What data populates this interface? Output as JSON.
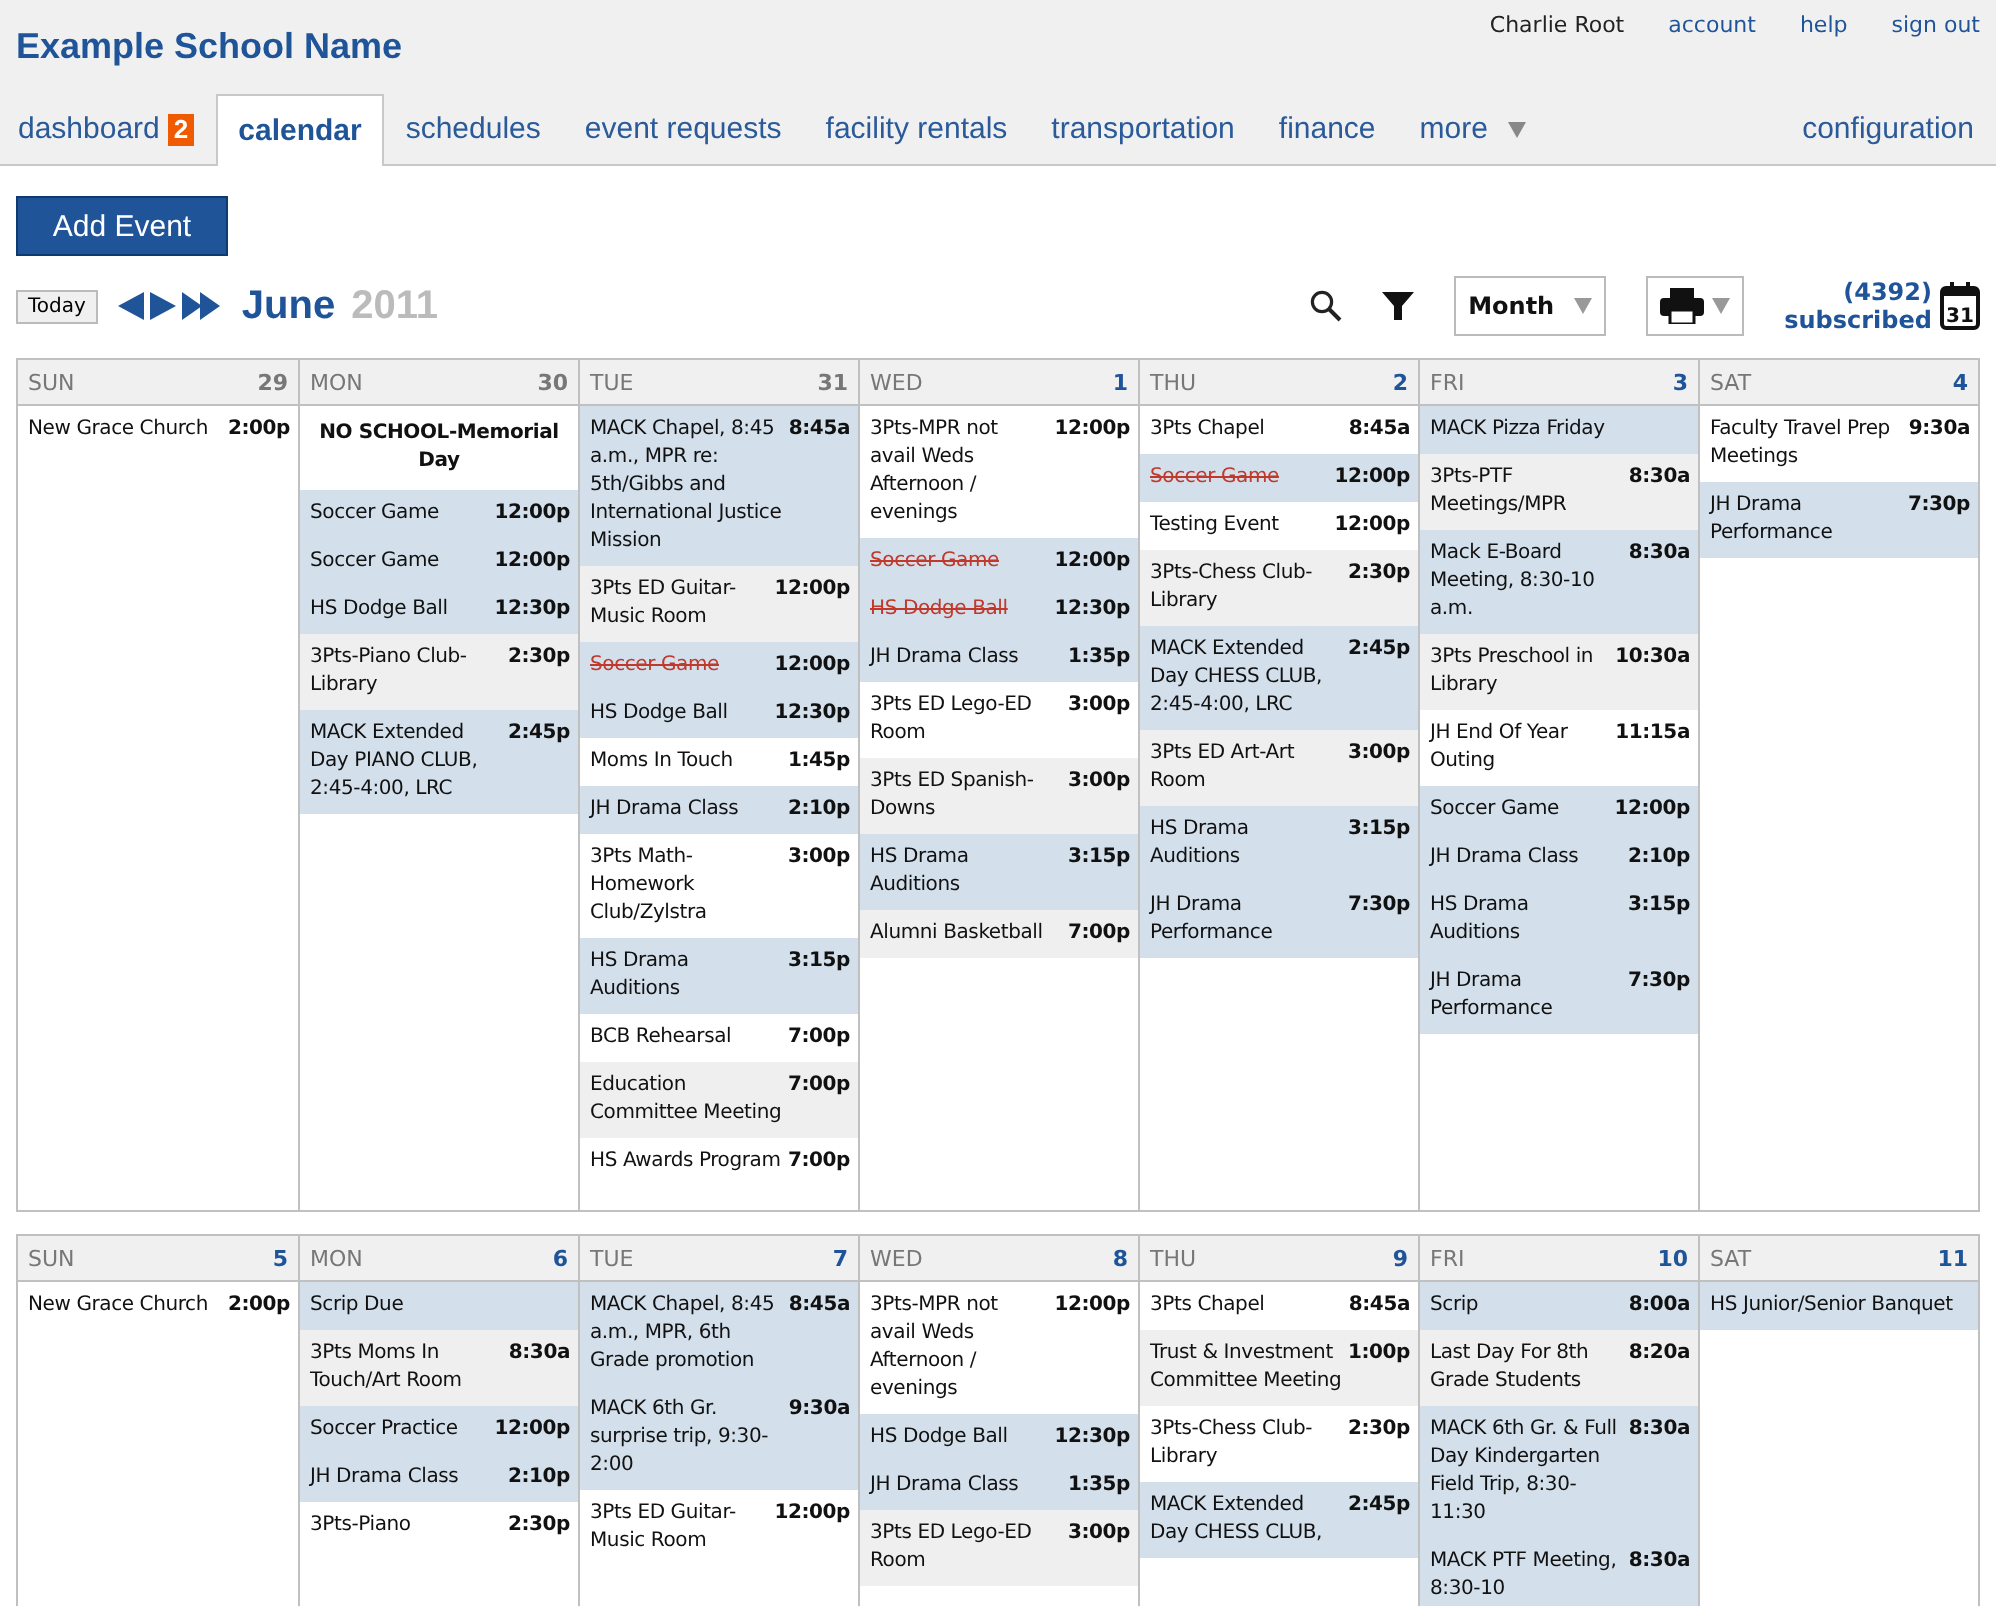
{
  "school_name": "Example School Name",
  "user_links": [
    {
      "label": "Charlie Root",
      "kind": "text"
    },
    {
      "label": "account",
      "kind": "link"
    },
    {
      "label": "help",
      "kind": "link"
    },
    {
      "label": "sign out",
      "kind": "link"
    }
  ],
  "tabs": [
    {
      "label": "dashboard",
      "badge": "2",
      "selected": false,
      "menu": false
    },
    {
      "label": "calendar",
      "selected": true,
      "menu": false
    },
    {
      "label": "schedules",
      "selected": false,
      "menu": false
    },
    {
      "label": "event requests",
      "selected": false,
      "menu": false
    },
    {
      "label": "facility rentals",
      "selected": false,
      "menu": false
    },
    {
      "label": "transportation",
      "selected": false,
      "menu": false
    },
    {
      "label": "finance",
      "selected": false,
      "menu": false
    },
    {
      "label": "more",
      "selected": false,
      "menu": true
    }
  ],
  "right_tab": {
    "label": "configuration"
  },
  "add_button": "Add Event",
  "toolbar": {
    "today": "Today",
    "month": "June",
    "year": "2011",
    "view_select": "Month",
    "count": "(4392)",
    "subscribed": "subscribed",
    "calendar_icon_label": "31"
  },
  "weeks": [
    {
      "days": [
        {
          "dow": "SUN",
          "date": "29",
          "other_month": true,
          "events": [
            {
              "kind": "event",
              "title": "New Grace Church",
              "time": "2:00p",
              "color": "#ffffff",
              "cancelled": false
            }
          ]
        },
        {
          "dow": "MON",
          "date": "30",
          "other_month": true,
          "events": [
            {
              "kind": "holiday",
              "title": "NO SCHOOL-Memorial Day",
              "color": "#ffffff",
              "cancelled": false
            },
            {
              "kind": "event",
              "title": "Soccer Game",
              "time": "12:00p",
              "color": "#d3dfeb",
              "cancelled": false
            },
            {
              "kind": "event",
              "title": "Soccer Game",
              "time": "12:00p",
              "color": "#d3dfeb",
              "cancelled": false
            },
            {
              "kind": "event",
              "title": "HS Dodge Ball",
              "time": "12:30p",
              "color": "#d3dfeb",
              "cancelled": false
            },
            {
              "kind": "event",
              "title": "3Pts-Piano Club-Library",
              "time": "2:30p",
              "color": "#efefef",
              "cancelled": false
            },
            {
              "kind": "event",
              "title": "MACK Extended Day PIANO CLUB, 2:45-4:00, LRC",
              "time": "2:45p",
              "color": "#d3dfeb",
              "cancelled": false
            }
          ]
        },
        {
          "dow": "TUE",
          "date": "31",
          "other_month": true,
          "events": [
            {
              "kind": "event",
              "title": "MACK Chapel, 8:45 a.m., MPR re: 5th/Gibbs and International Justice Mission",
              "time": "8:45a",
              "color": "#d3dfeb",
              "cancelled": false
            },
            {
              "kind": "event",
              "title": "3Pts ED Guitar-Music Room",
              "time": "12:00p",
              "color": "#efefef",
              "cancelled": false
            },
            {
              "kind": "event",
              "title": "Soccer Game",
              "time": "12:00p",
              "color": "#d3dfeb",
              "cancelled": true
            },
            {
              "kind": "event",
              "title": "HS Dodge Ball",
              "time": "12:30p",
              "color": "#d3dfeb",
              "cancelled": false
            },
            {
              "kind": "event",
              "title": "Moms In Touch",
              "time": "1:45p",
              "color": "#ffffff",
              "cancelled": false
            },
            {
              "kind": "event",
              "title": "JH Drama Class",
              "time": "2:10p",
              "color": "#d3dfeb",
              "cancelled": false
            },
            {
              "kind": "event",
              "title": "3Pts Math-Homework Club/Zylstra",
              "time": "3:00p",
              "color": "#ffffff",
              "cancelled": false
            },
            {
              "kind": "event",
              "title": "HS Drama Auditions",
              "time": "3:15p",
              "color": "#d3dfeb",
              "cancelled": false
            },
            {
              "kind": "event",
              "title": "BCB Rehearsal",
              "time": "7:00p",
              "color": "#ffffff",
              "cancelled": false
            },
            {
              "kind": "event",
              "title": "Education Committee Meeting",
              "time": "7:00p",
              "color": "#efefef",
              "cancelled": false
            },
            {
              "kind": "event",
              "title": "HS Awards Program",
              "time": "7:00p",
              "color": "#ffffff",
              "cancelled": false
            }
          ]
        },
        {
          "dow": "WED",
          "date": "1",
          "other_month": false,
          "events": [
            {
              "kind": "event",
              "title": "3Pts-MPR not avail Weds Afternoon / evenings",
              "time": "12:00p",
              "color": "#ffffff",
              "cancelled": false
            },
            {
              "kind": "event",
              "title": "Soccer Game",
              "time": "12:00p",
              "color": "#d3dfeb",
              "cancelled": true
            },
            {
              "kind": "event",
              "title": "HS Dodge Ball",
              "time": "12:30p",
              "color": "#d3dfeb",
              "cancelled": true
            },
            {
              "kind": "event",
              "title": "JH Drama Class",
              "time": "1:35p",
              "color": "#d3dfeb",
              "cancelled": false
            },
            {
              "kind": "event",
              "title": "3Pts ED Lego-ED Room",
              "time": "3:00p",
              "color": "#ffffff",
              "cancelled": false
            },
            {
              "kind": "event",
              "title": "3Pts ED Spanish-Downs",
              "time": "3:00p",
              "color": "#efefef",
              "cancelled": false
            },
            {
              "kind": "event",
              "title": "HS Drama Auditions",
              "time": "3:15p",
              "color": "#d3dfeb",
              "cancelled": false
            },
            {
              "kind": "event",
              "title": "Alumni Basketball",
              "time": "7:00p",
              "color": "#efefef",
              "cancelled": false
            }
          ]
        },
        {
          "dow": "THU",
          "date": "2",
          "other_month": false,
          "events": [
            {
              "kind": "event",
              "title": "3Pts Chapel",
              "time": "8:45a",
              "color": "#ffffff",
              "cancelled": false
            },
            {
              "kind": "event",
              "title": "Soccer Game",
              "time": "12:00p",
              "color": "#d3dfeb",
              "cancelled": true
            },
            {
              "kind": "event",
              "title": "Testing Event",
              "time": "12:00p",
              "color": "#ffffff",
              "cancelled": false
            },
            {
              "kind": "event",
              "title": "3Pts-Chess Club-Library",
              "time": "2:30p",
              "color": "#efefef",
              "cancelled": false
            },
            {
              "kind": "event",
              "title": "MACK Extended Day CHESS CLUB, 2:45-4:00, LRC",
              "time": "2:45p",
              "color": "#d3dfeb",
              "cancelled": false
            },
            {
              "kind": "event",
              "title": "3Pts ED Art-Art Room",
              "time": "3:00p",
              "color": "#efefef",
              "cancelled": false
            },
            {
              "kind": "event",
              "title": "HS Drama Auditions",
              "time": "3:15p",
              "color": "#d3dfeb",
              "cancelled": false
            },
            {
              "kind": "event",
              "title": "JH Drama Performance",
              "time": "7:30p",
              "color": "#d3dfeb",
              "cancelled": false
            }
          ]
        },
        {
          "dow": "FRI",
          "date": "3",
          "other_month": false,
          "events": [
            {
              "kind": "event",
              "title": "MACK Pizza Friday",
              "color": "#d3dfeb",
              "cancelled": false
            },
            {
              "kind": "event",
              "title": "3Pts-PTF Meetings/MPR",
              "time": "8:30a",
              "color": "#efefef",
              "cancelled": false
            },
            {
              "kind": "event",
              "title": "Mack E-Board Meeting, 8:30-10 a.m.",
              "time": "8:30a",
              "color": "#d3dfeb",
              "cancelled": false
            },
            {
              "kind": "event",
              "title": "3Pts Preschool in Library",
              "time": "10:30a",
              "color": "#efefef",
              "cancelled": false
            },
            {
              "kind": "event",
              "title": "JH End Of Year Outing",
              "time": "11:15a",
              "color": "#ffffff",
              "cancelled": false
            },
            {
              "kind": "event",
              "title": "Soccer Game",
              "time": "12:00p",
              "color": "#d3dfeb",
              "cancelled": false
            },
            {
              "kind": "event",
              "title": "JH Drama Class",
              "time": "2:10p",
              "color": "#d3dfeb",
              "cancelled": false
            },
            {
              "kind": "event",
              "title": "HS Drama Auditions",
              "time": "3:15p",
              "color": "#d3dfeb",
              "cancelled": false
            },
            {
              "kind": "event",
              "title": "JH Drama Performance",
              "time": "7:30p",
              "color": "#d3dfeb",
              "cancelled": false
            }
          ]
        },
        {
          "dow": "SAT",
          "date": "4",
          "other_month": false,
          "events": [
            {
              "kind": "event",
              "title": "Faculty Travel Prep Meetings",
              "time": "9:30a",
              "color": "#ffffff",
              "cancelled": false
            },
            {
              "kind": "event",
              "title": "JH Drama Performance",
              "time": "7:30p",
              "color": "#d3dfeb",
              "cancelled": false
            }
          ]
        }
      ]
    },
    {
      "days": [
        {
          "dow": "SUN",
          "date": "5",
          "other_month": false,
          "events": [
            {
              "kind": "event",
              "title": "New Grace Church",
              "time": "2:00p",
              "color": "#ffffff",
              "cancelled": false
            }
          ]
        },
        {
          "dow": "MON",
          "date": "6",
          "other_month": false,
          "events": [
            {
              "kind": "event",
              "title": "Scrip Due",
              "color": "#d3dfeb",
              "cancelled": false
            },
            {
              "kind": "event",
              "title": "3Pts Moms In Touch/Art Room",
              "time": "8:30a",
              "color": "#efefef",
              "cancelled": false
            },
            {
              "kind": "event",
              "title": "Soccer Practice",
              "time": "12:00p",
              "color": "#d3dfeb",
              "cancelled": false
            },
            {
              "kind": "event",
              "title": "JH Drama Class",
              "time": "2:10p",
              "color": "#d3dfeb",
              "cancelled": false
            },
            {
              "kind": "event",
              "title": "3Pts-Piano",
              "time": "2:30p",
              "color": "#ffffff",
              "cancelled": false
            }
          ]
        },
        {
          "dow": "TUE",
          "date": "7",
          "other_month": false,
          "events": [
            {
              "kind": "event",
              "title": "MACK Chapel, 8:45 a.m., MPR, 6th Grade promotion",
              "time": "8:45a",
              "color": "#d3dfeb",
              "cancelled": false
            },
            {
              "kind": "event",
              "title": "MACK 6th Gr. surprise trip, 9:30-2:00",
              "time": "9:30a",
              "color": "#d3dfeb",
              "cancelled": false
            },
            {
              "kind": "event",
              "title": "3Pts ED Guitar-Music Room",
              "time": "12:00p",
              "color": "#ffffff",
              "cancelled": false
            }
          ]
        },
        {
          "dow": "WED",
          "date": "8",
          "other_month": false,
          "events": [
            {
              "kind": "event",
              "title": "3Pts-MPR not avail Weds Afternoon / evenings",
              "time": "12:00p",
              "color": "#ffffff",
              "cancelled": false
            },
            {
              "kind": "event",
              "title": "HS Dodge Ball",
              "time": "12:30p",
              "color": "#d3dfeb",
              "cancelled": false
            },
            {
              "kind": "event",
              "title": "JH Drama Class",
              "time": "1:35p",
              "color": "#d3dfeb",
              "cancelled": false
            },
            {
              "kind": "event",
              "title": "3Pts ED Lego-ED Room",
              "time": "3:00p",
              "color": "#efefef",
              "cancelled": false
            }
          ]
        },
        {
          "dow": "THU",
          "date": "9",
          "other_month": false,
          "events": [
            {
              "kind": "event",
              "title": "3Pts Chapel",
              "time": "8:45a",
              "color": "#ffffff",
              "cancelled": false
            },
            {
              "kind": "event",
              "title": "Trust & Investment Committee Meeting",
              "time": "1:00p",
              "color": "#efefef",
              "cancelled": false
            },
            {
              "kind": "event",
              "title": "3Pts-Chess Club-Library",
              "time": "2:30p",
              "color": "#ffffff",
              "cancelled": false
            },
            {
              "kind": "event",
              "title": "MACK Extended Day CHESS CLUB,",
              "time": "2:45p",
              "color": "#d3dfeb",
              "cancelled": false
            }
          ]
        },
        {
          "dow": "FRI",
          "date": "10",
          "other_month": false,
          "events": [
            {
              "kind": "event",
              "title": "Scrip",
              "time": "8:00a",
              "color": "#d3dfeb",
              "cancelled": false
            },
            {
              "kind": "event",
              "title": "Last Day For 8th Grade Students",
              "time": "8:20a",
              "color": "#efefef",
              "cancelled": false
            },
            {
              "kind": "event",
              "title": "MACK 6th Gr. & Full Day Kindergarten Field Trip, 8:30-11:30",
              "time": "8:30a",
              "color": "#d3dfeb",
              "cancelled": false
            },
            {
              "kind": "event",
              "title": "MACK PTF Meeting, 8:30-10",
              "time": "8:30a",
              "color": "#d3dfeb",
              "cancelled": false
            }
          ]
        },
        {
          "dow": "SAT",
          "date": "11",
          "other_month": false,
          "events": [
            {
              "kind": "event",
              "title": "HS Junior/Senior Banquet",
              "color": "#d3dfeb",
              "cancelled": false
            }
          ]
        }
      ]
    }
  ]
}
